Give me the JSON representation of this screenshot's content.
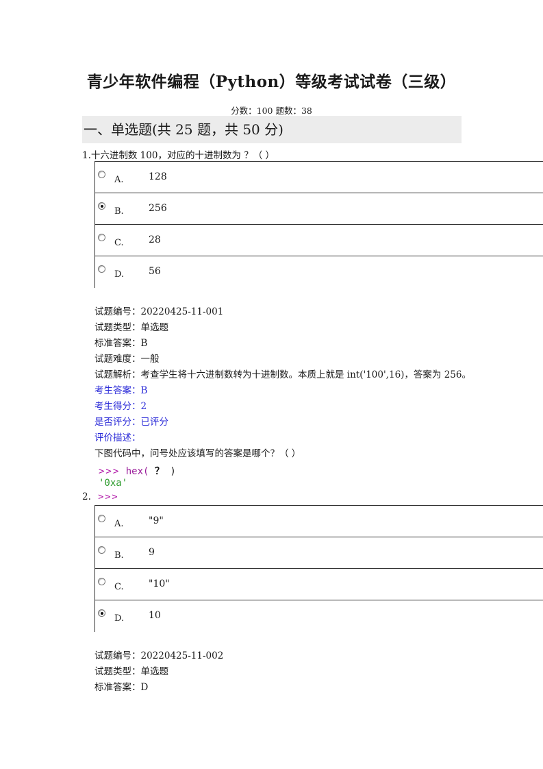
{
  "doc": {
    "title": "青少年软件编程（Python）等级考试试卷（三级）",
    "meta": "分数：100 题数：38",
    "section": "一、单选题(共 25 题，共 50 分)"
  },
  "q1": {
    "number": "1.",
    "stem": "十六进制数 100，对应的十进制数为 ？（ ）",
    "options": [
      {
        "letter": "A.",
        "text": "128",
        "selected": false
      },
      {
        "letter": "B.",
        "text": "256",
        "selected": true
      },
      {
        "letter": "C.",
        "text": "28",
        "selected": false
      },
      {
        "letter": "D.",
        "text": "56",
        "selected": false
      }
    ],
    "info": [
      "试题编号：20220425-11-001",
      "试题类型：单选题",
      "标准答案：B",
      "试题难度：一般",
      "试题解析：考查学生将十六进制数转为十进制数。本质上就是 int('100',16)，答案为 256。"
    ],
    "student": [
      "考生答案：B",
      "考生得分：2",
      "是否评分：已评分",
      "评价描述："
    ]
  },
  "q2": {
    "stem": "下图代码中，问号处应该填写的答案是哪个？（ ）",
    "code_prompt": ">>>",
    "code_fn": "hex(",
    "code_q": "？",
    "code_close": ")",
    "code_output": "'0xa'",
    "number": "2.",
    "prompt_line": ">>>",
    "options": [
      {
        "letter": "A.",
        "text": "\"9\"",
        "selected": false
      },
      {
        "letter": "B.",
        "text": "9",
        "selected": false
      },
      {
        "letter": "C.",
        "text": "\"10\"",
        "selected": false
      },
      {
        "letter": "D.",
        "text": "10",
        "selected": true
      }
    ],
    "info": [
      "试题编号：20220425-11-002",
      "试题类型：单选题",
      "标准答案：D"
    ]
  }
}
